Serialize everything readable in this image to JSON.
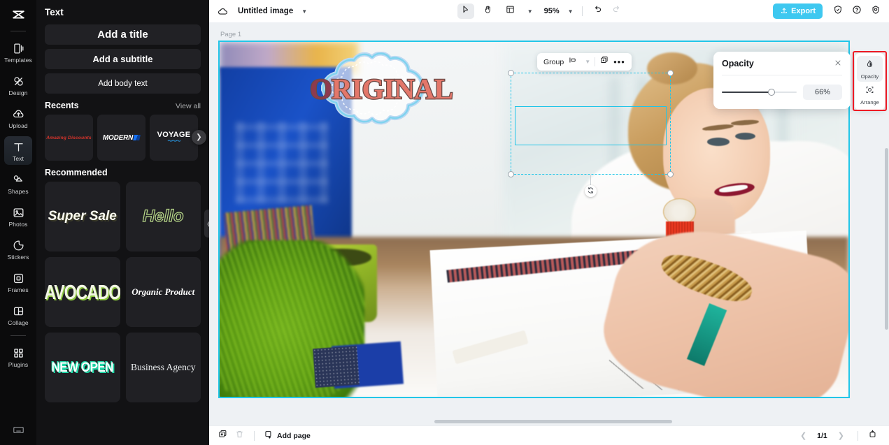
{
  "rail": {
    "logo_icon": "capcut-logo-icon",
    "items": [
      {
        "label": "Templates",
        "icon": "templates-icon",
        "active": false
      },
      {
        "label": "Design",
        "icon": "design-icon",
        "active": false
      },
      {
        "label": "Upload",
        "icon": "upload-cloud-icon",
        "active": false
      },
      {
        "label": "Text",
        "icon": "text-t-icon",
        "active": true
      },
      {
        "label": "Shapes",
        "icon": "shapes-icon",
        "active": false
      },
      {
        "label": "Photos",
        "icon": "photos-icon",
        "active": false
      },
      {
        "label": "Stickers",
        "icon": "stickers-icon",
        "active": false
      },
      {
        "label": "Frames",
        "icon": "frames-icon",
        "active": false
      },
      {
        "label": "Collage",
        "icon": "collage-icon",
        "active": false
      },
      {
        "label": "Plugins",
        "icon": "plugins-grid-icon",
        "active": false
      }
    ],
    "bottom_icon": "keyboard-shortcuts-icon"
  },
  "panel": {
    "title": "Text",
    "buttons": [
      {
        "label": "Add a title"
      },
      {
        "label": "Add a subtitle"
      },
      {
        "label": "Add body text"
      }
    ],
    "recents": {
      "title": "Recents",
      "view_all": "View all",
      "items": [
        {
          "label": "Amazing Discounts"
        },
        {
          "label": "MODERN"
        },
        {
          "label": "VOYAGE"
        }
      ],
      "next_icon": "chevron-right-icon"
    },
    "recommended": {
      "title": "Recommended",
      "items": [
        {
          "label": "Super Sale"
        },
        {
          "label": "Hello"
        },
        {
          "label": "AVOCADO"
        },
        {
          "label": "Organic Product"
        },
        {
          "label": "NEW OPEN"
        },
        {
          "label": "Business Agency"
        }
      ]
    },
    "collapse_icon": "chevron-left-icon"
  },
  "topbar": {
    "cloud_icon": "cloud-sync-icon",
    "doc_title": "Untitled image",
    "title_caret": "chevron-down-icon",
    "tools": [
      {
        "name": "select-tool",
        "icon": "cursor-arrow-icon",
        "selected": true
      },
      {
        "name": "hand-tool",
        "icon": "hand-icon",
        "selected": false
      },
      {
        "name": "layout-tool",
        "icon": "layout-panel-icon",
        "selected": false
      }
    ],
    "layout_caret": "chevron-down-icon",
    "zoom": "95%",
    "zoom_caret": "chevron-down-icon",
    "undo_icon": "undo-arrow-icon",
    "redo_icon": "redo-arrow-icon",
    "export_label": "Export",
    "export_icon": "export-upload-icon",
    "export_color": "#3ec8f0",
    "right_icons": [
      {
        "name": "shield-check-icon"
      },
      {
        "name": "help-question-icon"
      },
      {
        "name": "settings-gear-icon"
      }
    ]
  },
  "canvas": {
    "page_label": "Page 1",
    "selection_color": "#21c5e8",
    "rotate_icon": "rotate-handle-icon",
    "art_text": "ORIGINAL",
    "art_text_color": "#e3776a",
    "art_text_stroke": "#6b4a46"
  },
  "float_toolbar": {
    "group_label": "Group",
    "align_icon": "align-left-icon",
    "align_caret": "chevron-down-icon",
    "duplicate_icon": "duplicate-layers-icon",
    "more_icon": "more-horizontal-icon"
  },
  "opacity_panel": {
    "title": "Opacity",
    "close_icon": "close-x-icon",
    "value": "66%",
    "slider_percent": 66
  },
  "right_tools": {
    "items": [
      {
        "label": "Opacity",
        "icon": "opacity-droplet-icon",
        "active": true
      },
      {
        "label": "Arrange",
        "icon": "arrange-frame-icon",
        "active": false
      }
    ],
    "highlight_color": "#ee1a24"
  },
  "bottombar": {
    "duplicate_icon": "duplicate-page-icon",
    "delete_icon": "trash-icon",
    "add_page_icon": "add-page-icon",
    "add_page_label": "Add page",
    "prev_icon": "chevron-left-icon",
    "page_indicator": "1/1",
    "next_icon": "chevron-right-icon",
    "grid_view_icon": "page-grid-icon"
  }
}
